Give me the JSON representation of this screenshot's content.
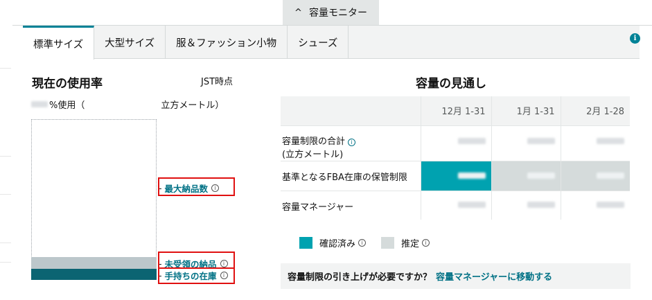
{
  "toggle": {
    "chevron": "^",
    "label": "容量モニター"
  },
  "tabs": [
    {
      "label": "標準サイズ",
      "active": true
    },
    {
      "label": "大型サイズ",
      "active": false
    },
    {
      "label": "服＆ファッション小物",
      "active": false
    },
    {
      "label": "シューズ",
      "active": false
    }
  ],
  "info_icon": "i",
  "current_usage": {
    "title": "現在の使用率",
    "timestamp_suffix": "JST時点",
    "percent_label": "%使用（",
    "unit_label": "立方メートル）",
    "markers": {
      "max_inbound": "最大納品数",
      "pending_inbound": "未受領の納品",
      "on_hand": "手持ちの在庫"
    },
    "info_glyph": "i"
  },
  "outlook": {
    "title": "容量の見通し",
    "columns": [
      "12月 1-31",
      "1月 1-31",
      "2月 1-28"
    ],
    "rows": [
      {
        "label": "容量制限の合計",
        "sublabel": "(立方メートル)"
      },
      {
        "label": "基準となるFBA在庫の保管制限"
      },
      {
        "label": "容量マネージャー"
      }
    ],
    "legend": {
      "confirmed": "確認済み",
      "estimated": "推定"
    },
    "colors": {
      "confirmed": "#00a2b0",
      "estimated": "#d5dbdb",
      "on_hand": "#0b6472",
      "pending": "#bcc7cb",
      "accent": "#008296"
    }
  },
  "cta": {
    "question": "容量制限の引き上げが必要ですか？",
    "link": "容量マネージャーに移動する"
  }
}
